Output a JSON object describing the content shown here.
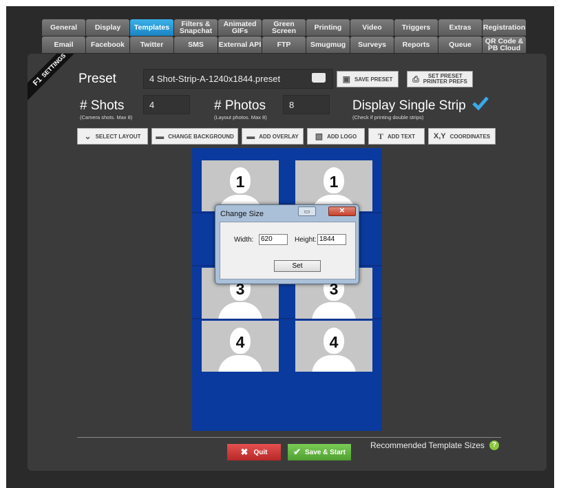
{
  "tabs_row1": [
    "General",
    "Display",
    "Templates",
    "Filters &\nSnapchat",
    "Animated\nGIFs",
    "Green\nScreen",
    "Printing",
    "Video",
    "Triggers",
    "Extras",
    "Registration"
  ],
  "tabs_row2": [
    "Email",
    "Facebook",
    "Twitter",
    "SMS",
    "External API",
    "FTP",
    "Smugmug",
    "Surveys",
    "Reports",
    "Queue",
    "QR Code &\nPB Cloud"
  ],
  "active_tab": "Templates",
  "ribbon": {
    "key": "F1",
    "label": "SETTINGS"
  },
  "preset": {
    "label": "Preset",
    "value": "4 Shot-Strip-A-1240x1844.preset",
    "folder_icon": "folder-open-icon"
  },
  "save_preset": "SAVE PRESET",
  "printer_prefs": "SET PRESET\nPRINTER PREFS",
  "shots": {
    "label": "# Shots",
    "hint": "(Camera shots. Max 8)",
    "value": "4"
  },
  "photos": {
    "label": "# Photos",
    "hint": "(Layout photos. Max 8)",
    "value": "8"
  },
  "single_strip": {
    "label": "Display Single Strip",
    "hint": "(Check if printing double strips)",
    "checked": true
  },
  "toolbar": {
    "select_layout": "SELECT LAYOUT",
    "change_background": "CHANGE BACKGROUND",
    "add_overlay": "ADD OVERLAY",
    "add_logo": "ADD LOGO",
    "add_text": "ADD TEXT",
    "coordinates_icon": "X,Y",
    "coordinates": "COORDINATES"
  },
  "strip_numbers": {
    "c1": "1",
    "c2": "1",
    "c3": "3",
    "c4": "3",
    "c5": "4",
    "c6": "4"
  },
  "dialog": {
    "title": "Change Size",
    "width_label": "Width:",
    "width_value": "620",
    "height_label": "Height:",
    "height_value": "1844",
    "set": "Set"
  },
  "bottom": {
    "quit": "Quit",
    "save_start": "Save & Start",
    "recommended": "Recommended Template Sizes",
    "help": "?"
  },
  "colors": {
    "accent": "#1b84c4",
    "strip": "#0b3a9e",
    "quit": "#c83030",
    "save": "#5aad38"
  }
}
